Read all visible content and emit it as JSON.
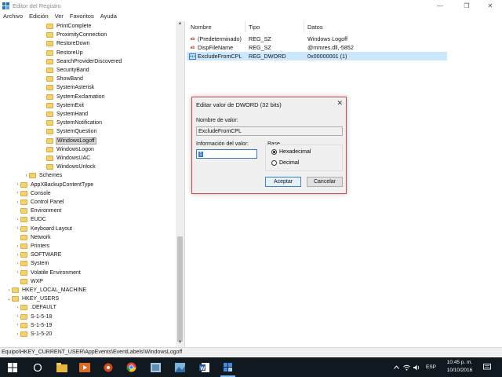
{
  "window": {
    "title": "Editor del Registro",
    "minimize": "—",
    "maximize": "❐",
    "close": "✕"
  },
  "menu": [
    "Archivo",
    "Edición",
    "Ver",
    "Favoritos",
    "Ayuda"
  ],
  "tree": [
    {
      "label": "PrintComplete",
      "indent": 52,
      "chev": ""
    },
    {
      "label": "ProximityConnection",
      "indent": 52,
      "chev": ""
    },
    {
      "label": "RestoreDown",
      "indent": 52,
      "chev": ""
    },
    {
      "label": "RestoreUp",
      "indent": 52,
      "chev": ""
    },
    {
      "label": "SearchProviderDiscovered",
      "indent": 52,
      "chev": ""
    },
    {
      "label": "SecurityBand",
      "indent": 52,
      "chev": ""
    },
    {
      "label": "ShowBand",
      "indent": 52,
      "chev": ""
    },
    {
      "label": "SystemAsterisk",
      "indent": 52,
      "chev": ""
    },
    {
      "label": "SystemExclamation",
      "indent": 52,
      "chev": ""
    },
    {
      "label": "SystemExit",
      "indent": 52,
      "chev": ""
    },
    {
      "label": "SystemHand",
      "indent": 52,
      "chev": ""
    },
    {
      "label": "SystemNotification",
      "indent": 52,
      "chev": ""
    },
    {
      "label": "SystemQuestion",
      "indent": 52,
      "chev": ""
    },
    {
      "label": "WindowsLogoff",
      "indent": 52,
      "chev": "",
      "selected": true
    },
    {
      "label": "WindowsLogon",
      "indent": 52,
      "chev": ""
    },
    {
      "label": "WindowsUAC",
      "indent": 52,
      "chev": ""
    },
    {
      "label": "WindowsUnlock",
      "indent": 52,
      "chev": ""
    },
    {
      "label": "Schemes",
      "indent": 30,
      "chev": "›"
    },
    {
      "label": "AppXBackupContentType",
      "indent": 19,
      "chev": "›"
    },
    {
      "label": "Console",
      "indent": 19,
      "chev": "›"
    },
    {
      "label": "Control Panel",
      "indent": 19,
      "chev": "›"
    },
    {
      "label": "Environment",
      "indent": 19,
      "chev": ""
    },
    {
      "label": "EUDC",
      "indent": 19,
      "chev": "›"
    },
    {
      "label": "Keyboard Layout",
      "indent": 19,
      "chev": "›"
    },
    {
      "label": "Network",
      "indent": 19,
      "chev": ""
    },
    {
      "label": "Printers",
      "indent": 19,
      "chev": "›"
    },
    {
      "label": "SOFTWARE",
      "indent": 19,
      "chev": "›"
    },
    {
      "label": "System",
      "indent": 19,
      "chev": "›"
    },
    {
      "label": "Volatile Environment",
      "indent": 19,
      "chev": "›"
    },
    {
      "label": "WXP",
      "indent": 19,
      "chev": ""
    },
    {
      "label": "HKEY_LOCAL_MACHINE",
      "indent": 8,
      "chev": "›"
    },
    {
      "label": "HKEY_USERS",
      "indent": 8,
      "chev": "⌄"
    },
    {
      "label": ".DEFAULT",
      "indent": 19,
      "chev": "›"
    },
    {
      "label": "S-1-5-18",
      "indent": 19,
      "chev": "›"
    },
    {
      "label": "S-1-5-19",
      "indent": 19,
      "chev": "›"
    },
    {
      "label": "S-1-5-20",
      "indent": 19,
      "chev": "›"
    }
  ],
  "columns": {
    "name": "Nombre",
    "type": "Tipo",
    "data": "Datos"
  },
  "values": [
    {
      "icon": "ab",
      "name": "(Predeterminado)",
      "type": "REG_SZ",
      "data": "Windows Logoff"
    },
    {
      "icon": "ab",
      "name": "DispFileName",
      "type": "REG_SZ",
      "data": "@mmres.dll,-5852"
    },
    {
      "icon": "011",
      "name": "ExcludeFromCPL",
      "type": "REG_DWORD",
      "data": "0x00000001 (1)",
      "selected": true
    }
  ],
  "statusbar": "Equipo\\HKEY_CURRENT_USER\\AppEvents\\EventLabels\\WindowsLogoff",
  "dialog": {
    "title": "Editar valor de DWORD (32 bits)",
    "close": "✕",
    "name_label": "Nombre de valor:",
    "name_value": "ExcludeFromCPL",
    "info_label": "Información del valor:",
    "info_value": "1",
    "base_label": "Base",
    "hex_label": "Hexadecimal",
    "dec_label": "Decimal",
    "ok": "Aceptar",
    "cancel": "Cancelar"
  },
  "taskbar": {
    "time": "10:45 p. m.",
    "date": "10/10/2016",
    "lang": "ESP",
    "accent": "#7db8ee"
  }
}
